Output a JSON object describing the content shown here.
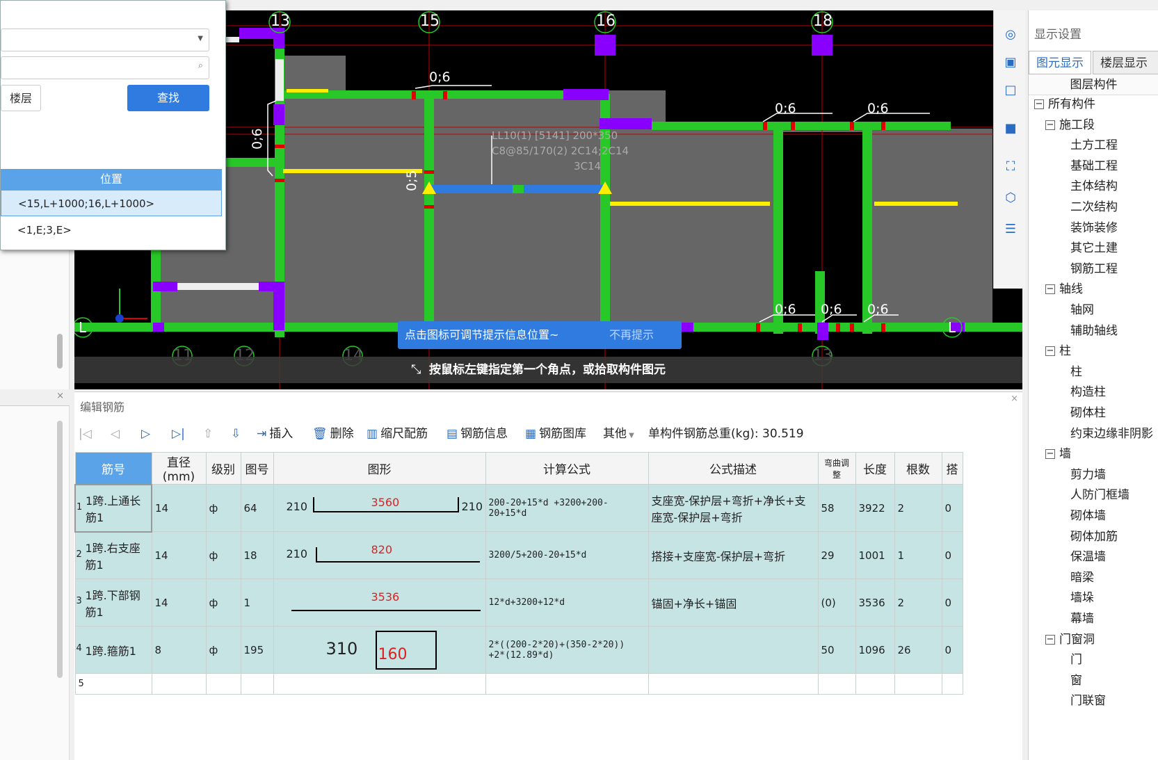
{
  "find_dialog": {
    "floor_button": "楼层",
    "find_button": "查找",
    "table_header": "位置",
    "rows": [
      "<15,L+1000;16,L+1000>",
      "<1,E;3,E>"
    ]
  },
  "cad": {
    "axis_top": [
      "13",
      "15",
      "16",
      "18"
    ],
    "axis_bottom": [
      "11",
      "12",
      "14",
      "13"
    ],
    "axis_side": "L",
    "dims": [
      "0;6",
      "0;6",
      "0;6",
      "0;6",
      "0;6",
      "0;6",
      "0;6",
      "0;5",
      "0;6"
    ],
    "beam_label_1": "LL10(1) [5141] 200*350",
    "beam_label_2": "C8@85/170(2) 2C14;2C14",
    "beam_label_3": "3C14",
    "hint_text": "点击图标可调节提示信息位置~",
    "hint_dismiss": "不再提示",
    "status_text": "按鼠标左键指定第一个角点，或拾取构件图元"
  },
  "right_panel": {
    "title": "显示设置",
    "tab_1": "图元显示",
    "tab_2": "楼层显示",
    "col_header": "图层构件",
    "tree": [
      {
        "label": "所有构件",
        "level": 0,
        "expander": true
      },
      {
        "label": "施工段",
        "level": 1,
        "expander": true
      },
      {
        "label": "土方工程",
        "level": 2
      },
      {
        "label": "基础工程",
        "level": 2
      },
      {
        "label": "主体结构",
        "level": 2
      },
      {
        "label": "二次结构",
        "level": 2
      },
      {
        "label": "装饰装修",
        "level": 2
      },
      {
        "label": "其它土建",
        "level": 2
      },
      {
        "label": "钢筋工程",
        "level": 2
      },
      {
        "label": "轴线",
        "level": 1,
        "expander": true
      },
      {
        "label": "轴网",
        "level": 2
      },
      {
        "label": "辅助轴线",
        "level": 2
      },
      {
        "label": "柱",
        "level": 1,
        "expander": true
      },
      {
        "label": "柱",
        "level": 2
      },
      {
        "label": "构造柱",
        "level": 2
      },
      {
        "label": "砌体柱",
        "level": 2
      },
      {
        "label": "约束边缘非阴影",
        "level": 2
      },
      {
        "label": "墙",
        "level": 1,
        "expander": true
      },
      {
        "label": "剪力墙",
        "level": 2
      },
      {
        "label": "人防门框墙",
        "level": 2
      },
      {
        "label": "砌体墙",
        "level": 2
      },
      {
        "label": "砌体加筋",
        "level": 2
      },
      {
        "label": "保温墙",
        "level": 2
      },
      {
        "label": "暗梁",
        "level": 2
      },
      {
        "label": "墙垛",
        "level": 2
      },
      {
        "label": "幕墙",
        "level": 2
      },
      {
        "label": "门窗洞",
        "level": 1,
        "expander": true
      },
      {
        "label": "门",
        "level": 2
      },
      {
        "label": "窗",
        "level": 2
      },
      {
        "label": "门联窗",
        "level": 2
      }
    ]
  },
  "edit_panel": {
    "title": "编辑钢筋",
    "toolbar": {
      "insert": "插入",
      "delete": "删除",
      "scale": "缩尺配筋",
      "info": "钢筋信息",
      "library": "钢筋图库",
      "other": "其他",
      "total_weight": "单构件钢筋总重(kg): 30.519"
    },
    "columns": [
      "筋号",
      "直径(mm)",
      "级别",
      "图号",
      "图形",
      "计算公式",
      "公式描述",
      "弯曲调整",
      "长度",
      "根数",
      "搭"
    ],
    "rows": [
      {
        "idx": "1",
        "name": "1跨.上通长筋1",
        "dia": "14",
        "grade": "ф",
        "fig": "64",
        "shape_l": "210",
        "shape_m": "3560",
        "shape_r": "210",
        "formula": "200-20+15*d +3200+200-20+15*d",
        "desc": "支座宽-保护层+弯折+净长+支座宽-保护层+弯折",
        "bend": "58",
        "len": "3922",
        "count": "2",
        "lap": "0"
      },
      {
        "idx": "2",
        "name": "1跨.右支座筋1",
        "dia": "14",
        "grade": "ф",
        "fig": "18",
        "shape_l": "210",
        "shape_m": "820",
        "shape_r": "",
        "formula": "3200/5+200-20+15*d",
        "desc": "搭接+支座宽-保护层+弯折",
        "bend": "29",
        "len": "1001",
        "count": "1",
        "lap": "0"
      },
      {
        "idx": "3",
        "name": "1跨.下部钢筋1",
        "dia": "14",
        "grade": "ф",
        "fig": "1",
        "shape_l": "",
        "shape_m": "3536",
        "shape_r": "",
        "formula": "12*d+3200+12*d",
        "desc": "锚固+净长+锚固",
        "bend": "(0)",
        "len": "3536",
        "count": "2",
        "lap": "0"
      },
      {
        "idx": "4",
        "name": "1跨.箍筋1",
        "dia": "8",
        "grade": "ф",
        "fig": "195",
        "shape_l": "310",
        "shape_m": "160",
        "shape_r": "",
        "formula": "2*((200-2*20)+(350-2*20)) +2*(12.89*d)",
        "desc": "",
        "bend": "50",
        "len": "1096",
        "count": "26",
        "lap": "0"
      }
    ],
    "empty_row_idx": "5"
  }
}
